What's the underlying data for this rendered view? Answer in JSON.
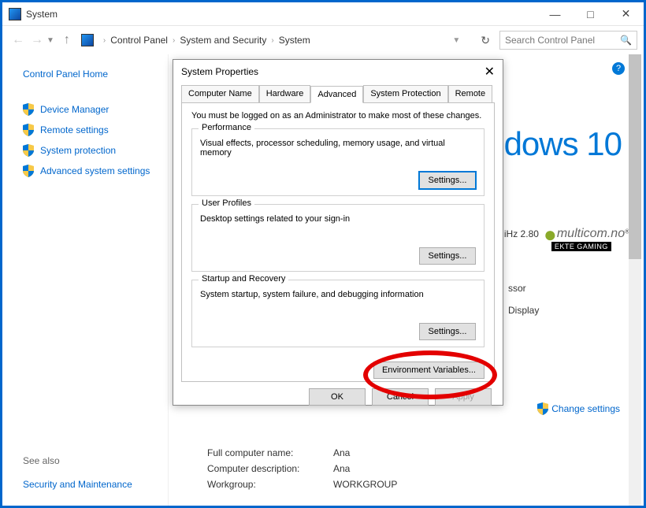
{
  "titlebar": {
    "title": "System"
  },
  "nav": {
    "crumbs": [
      "Control Panel",
      "System and Security",
      "System"
    ],
    "search_placeholder": "Search Control Panel"
  },
  "sidebar": {
    "home": "Control Panel Home",
    "links": [
      "Device Manager",
      "Remote settings",
      "System protection",
      "Advanced system settings"
    ],
    "see_also_label": "See also",
    "see_also": "Security and Maintenance"
  },
  "content": {
    "windows_brand": "dows 10",
    "ghz": "iHz   2.80",
    "info_rows": [
      {
        "label": "ssor",
        "val": ""
      },
      {
        "label": "Display",
        "val": ""
      }
    ],
    "change_settings": "Change settings",
    "multicom_brand": "multicom.no",
    "multicom_tag": "EKTE GAMING",
    "bottom": [
      {
        "label": "Full computer name:",
        "val": "Ana"
      },
      {
        "label": "Computer description:",
        "val": "Ana"
      },
      {
        "label": "Workgroup:",
        "val": "WORKGROUP"
      }
    ]
  },
  "dialog": {
    "title": "System Properties",
    "tabs": [
      "Computer Name",
      "Hardware",
      "Advanced",
      "System Protection",
      "Remote"
    ],
    "active_tab": 2,
    "admin_note": "You must be logged on as an Administrator to make most of these changes.",
    "groups": [
      {
        "legend": "Performance",
        "desc": "Visual effects, processor scheduling, memory usage, and virtual memory",
        "btn": "Settings..."
      },
      {
        "legend": "User Profiles",
        "desc": "Desktop settings related to your sign-in",
        "btn": "Settings..."
      },
      {
        "legend": "Startup and Recovery",
        "desc": "System startup, system failure, and debugging information",
        "btn": "Settings..."
      }
    ],
    "env_btn": "Environment Variables...",
    "footer": {
      "ok": "OK",
      "cancel": "Cancel",
      "apply": "Apply"
    }
  }
}
